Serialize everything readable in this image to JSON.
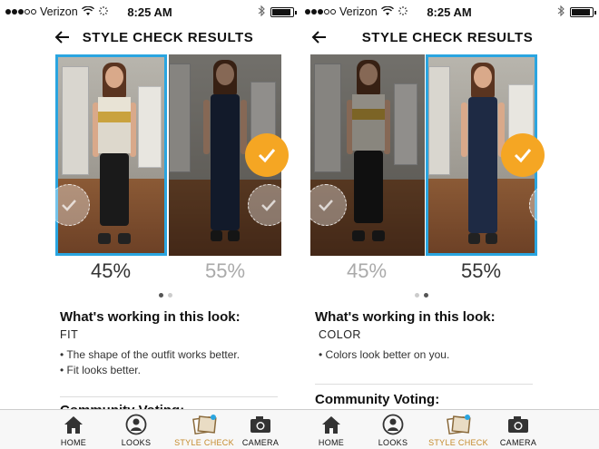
{
  "status_bar": {
    "carrier": "Verizon",
    "time": "8:25 AM"
  },
  "header": {
    "title": "STYLE CHECK RESULTS"
  },
  "left_screen": {
    "percent_a": "45%",
    "percent_b": "55%",
    "selected_photo": "left",
    "section_title": "What's working in this look:",
    "tag": "FIT",
    "bullets": [
      "The shape of the outfit works better.",
      "Fit looks better."
    ],
    "next_section_partial": "Community Voting:"
  },
  "right_screen": {
    "percent_a": "45%",
    "percent_b": "55%",
    "selected_photo": "right",
    "section_title": "What's working in this look:",
    "tag": "COLOR",
    "bullets": [
      "Colors look better on you."
    ],
    "next_section": "Community Voting:"
  },
  "tabs": [
    {
      "label": "HOME",
      "icon": "home-icon"
    },
    {
      "label": "LOOKS",
      "icon": "looks-icon"
    },
    {
      "label": "STYLE CHECK",
      "icon": "style-check-icon",
      "active": true
    },
    {
      "label": "CAMERA",
      "icon": "camera-icon"
    }
  ],
  "colors": {
    "accent_blue": "#2aa5e0",
    "check_orange": "#f5a623",
    "active_tab": "#c58a2b"
  }
}
